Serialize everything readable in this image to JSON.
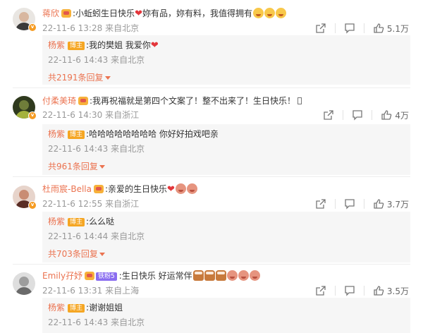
{
  "comments": [
    {
      "username": "蒋欣",
      "text": ":小蚯蚓生日快乐",
      "text_after": "妳有品，妳有料，我值得拥有",
      "time": "22-11-6 13:28",
      "location": "来自北京",
      "likes": "5.1万",
      "reply": {
        "name": "杨紫",
        "badge": "博主",
        "text": ":我的樊姐 我爱你",
        "time": "22-11-6 14:43",
        "location": "来自北京"
      },
      "more_replies": "共2191条回复"
    },
    {
      "username": "付柔美琦",
      "text": ":我再祝福就是第四个文案了！整不出来了！生日快乐！",
      "text_after": "",
      "time": "22-11-6 14:30",
      "location": "来自浙江",
      "likes": "4万",
      "reply": {
        "name": "杨紫",
        "badge": "博主",
        "text": ":哈哈哈哈哈哈哈哈 你好好拍戏吧亲",
        "time": "22-11-6 14:43",
        "location": "来自北京"
      },
      "more_replies": "共961条回复"
    },
    {
      "username": "杜雨宸-Bella",
      "text": ":亲爱的生日快乐",
      "text_after": "",
      "time": "22-11-6 12:55",
      "location": "来自浙江",
      "likes": "3.7万",
      "reply": {
        "name": "杨紫",
        "badge": "博主",
        "text": ":么么哒",
        "time": "22-11-6 14:44",
        "location": "来自北京"
      },
      "more_replies": "共703条回复"
    },
    {
      "username": "Emily孖妤",
      "tag": "铁粉5",
      "text": ":生日快乐 好运常伴",
      "text_after": "",
      "time": "22-11-6 13:31",
      "location": "来自上海",
      "likes": "3.5万",
      "reply": {
        "name": "杨紫",
        "badge": "博主",
        "text": ":谢谢姐姐",
        "time": "22-11-6 14:43",
        "location": "来自北京"
      }
    }
  ],
  "icons": {
    "share": "share-icon",
    "comment": "comment-icon",
    "like": "thumbs-up-icon"
  },
  "colors": {
    "username": "#eb7350",
    "meta": "#999999",
    "reply_bg": "#f6f6f6",
    "badge": "#f5a623",
    "verified": "#f59b22"
  }
}
